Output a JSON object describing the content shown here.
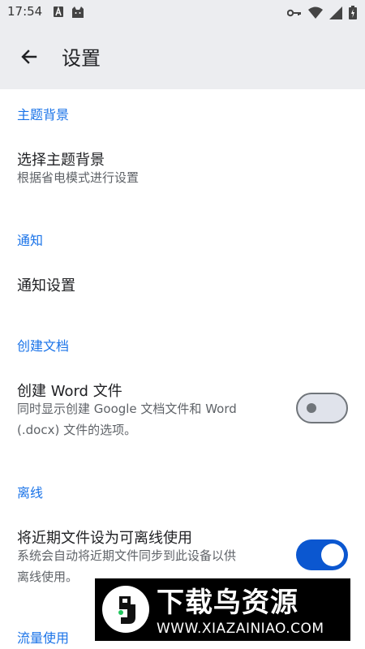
{
  "status_bar": {
    "time": "17:54",
    "left_icons": [
      "notification-a-icon",
      "cat-icon"
    ],
    "right_icons": [
      "key-icon",
      "wifi-icon",
      "signal-icon",
      "battery-icon"
    ]
  },
  "app_bar": {
    "back_icon": "arrow-left-icon",
    "title": "设置"
  },
  "sections": [
    {
      "header": "主题背景",
      "items": [
        {
          "title": "选择主题背景",
          "subtitle": "根据省电模式进行设置"
        }
      ]
    },
    {
      "header": "通知",
      "items": [
        {
          "title": "通知设置"
        }
      ]
    },
    {
      "header": "创建文档",
      "items": [
        {
          "title": "创建 Word 文件",
          "subtitle_line1": "同时显示创建 Google 文档文件和 Word",
          "subtitle_line2": "(.docx) 文件的选项。",
          "toggle": false
        }
      ]
    },
    {
      "header": "离线",
      "items": [
        {
          "title": "将近期文件设为可离线使用",
          "subtitle_line1": "系统会自动将近期文件同步到此设备以供",
          "subtitle_line2": "离线使用。",
          "toggle": true
        }
      ]
    },
    {
      "header": "流量使用",
      "items": []
    }
  ],
  "watermark": {
    "title": "下载鸟资源",
    "url": "WWW.XIAZAINIAO.COM"
  },
  "colors": {
    "accent": "#1a73e8",
    "toggle_on": "#0b57d0",
    "bar_bg": "#ecedf0"
  }
}
